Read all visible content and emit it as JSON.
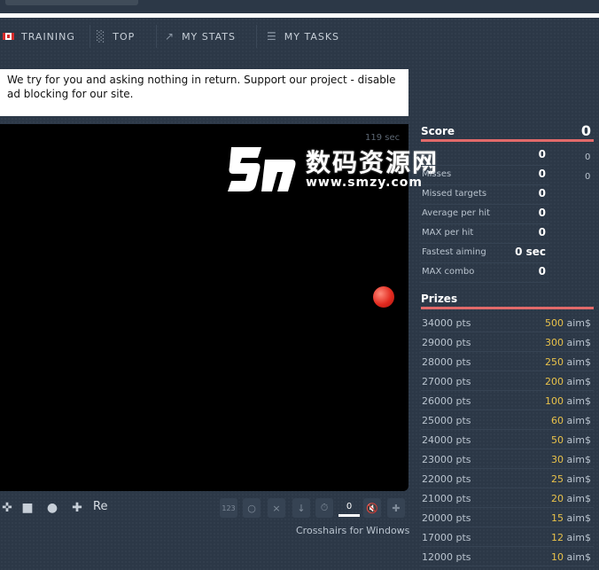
{
  "nav": {
    "items": [
      {
        "label": "TRAINING",
        "icon": "canada-flag-icon"
      },
      {
        "label": "TOP",
        "icon": "podium-icon"
      },
      {
        "label": "MY STATS",
        "icon": "line-chart-icon"
      },
      {
        "label": "MY TASKS",
        "icon": "list-icon"
      }
    ]
  },
  "notice": {
    "text": "We try for you and asking nothing in return. Support our project - disable ad blocking for our site."
  },
  "game": {
    "timer": "119 sec"
  },
  "watermark": {
    "cn": "数码资源网",
    "url": "www.smzy.com"
  },
  "toolbar": {
    "re_label": "Re",
    "counter_label": "123",
    "slider_value": "0",
    "crosshairs_link": "Crosshairs for Windows"
  },
  "score": {
    "label": "Score",
    "value": "0"
  },
  "stats": [
    {
      "label": "",
      "value": "0",
      "extra": "0"
    },
    {
      "label": "Misses",
      "value": "0",
      "extra": "0"
    },
    {
      "label": "Missed targets",
      "value": "0"
    },
    {
      "label": "Average per hit",
      "value": "0"
    },
    {
      "label": "MAX per hit",
      "value": "0"
    },
    {
      "label": "Fastest aiming",
      "value": "0 sec"
    },
    {
      "label": "MAX combo",
      "value": "0"
    }
  ],
  "prizes": {
    "label": "Prizes",
    "currency": "aim$",
    "items": [
      {
        "pts": "34000 pts",
        "amount": "500"
      },
      {
        "pts": "29000 pts",
        "amount": "300"
      },
      {
        "pts": "28000 pts",
        "amount": "250"
      },
      {
        "pts": "27000 pts",
        "amount": "200"
      },
      {
        "pts": "26000 pts",
        "amount": "100"
      },
      {
        "pts": "25000 pts",
        "amount": "60"
      },
      {
        "pts": "24000 pts",
        "amount": "50"
      },
      {
        "pts": "23000 pts",
        "amount": "30"
      },
      {
        "pts": "22000 pts",
        "amount": "25"
      },
      {
        "pts": "21000 pts",
        "amount": "20"
      },
      {
        "pts": "20000 pts",
        "amount": "15"
      },
      {
        "pts": "17000 pts",
        "amount": "12"
      },
      {
        "pts": "12000 pts",
        "amount": "10"
      }
    ]
  },
  "colors": {
    "accent_red": "#e26a6a",
    "prize_gold": "#e9c24a",
    "target_red": "#e22a1f"
  }
}
